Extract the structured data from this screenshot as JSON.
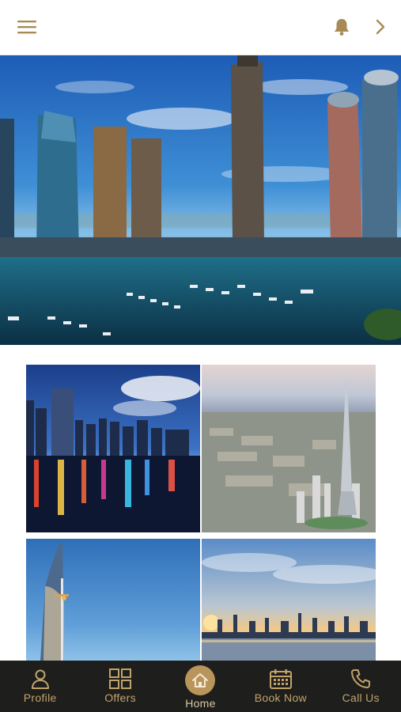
{
  "header": {
    "icons": {
      "menu": "hamburger-menu-icon",
      "notifications": "bell-icon",
      "next": "chevron-right-icon"
    },
    "accent_color": "#a88a55"
  },
  "hero": {
    "image": "dubai-marina-skyline-photo"
  },
  "gallery": {
    "tiles": [
      {
        "image": "city-skyline-night-reflection-photo"
      },
      {
        "image": "burj-khalifa-aerial-photo"
      },
      {
        "image": "burj-al-arab-tower-photo"
      },
      {
        "image": "skyline-sunset-waterfront-photo"
      }
    ]
  },
  "bottom_nav": {
    "background": "#1e1e1c",
    "accent_color": "#c2a36b",
    "items": [
      {
        "label": "Profile",
        "icon": "person-icon"
      },
      {
        "label": "Offers",
        "icon": "grid-icon"
      },
      {
        "label": "Home",
        "icon": "home-icon",
        "active": true
      },
      {
        "label": "Book Now",
        "icon": "calendar-icon"
      },
      {
        "label": "Call Us",
        "icon": "phone-icon"
      }
    ]
  }
}
